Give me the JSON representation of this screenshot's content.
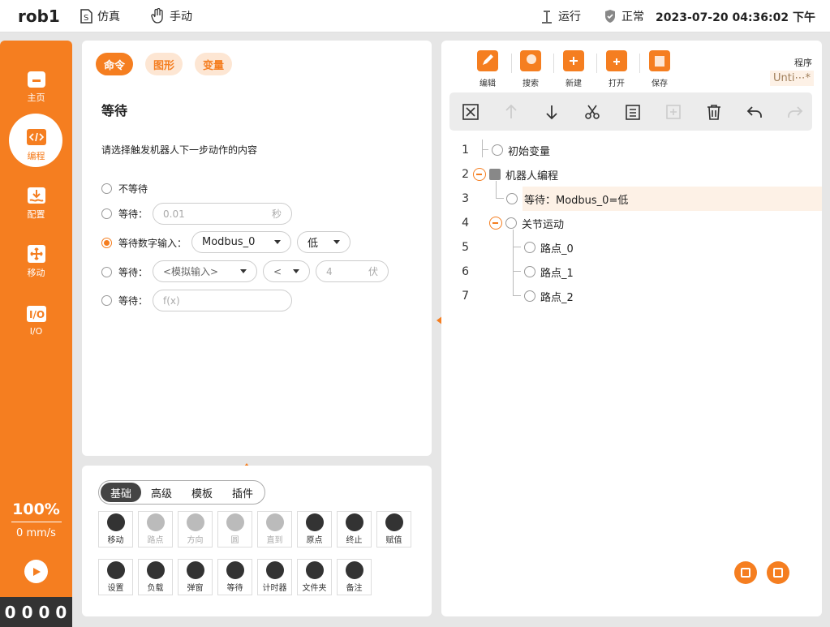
{
  "header": {
    "robot_name": "rob1",
    "mode_sim": "仿真",
    "mode_manual": "手动",
    "run_status": "运行",
    "health_status": "正常",
    "datetime": "2023-07-20 04:36:02 下午"
  },
  "sidebar": {
    "items": [
      {
        "label": "主页",
        "icon": "home-icon"
      },
      {
        "label": "编程",
        "icon": "code-icon"
      },
      {
        "label": "配置",
        "icon": "config-icon"
      },
      {
        "label": "移动",
        "icon": "move-icon"
      },
      {
        "label": "I/O",
        "icon": "io-icon"
      }
    ],
    "active": "编程",
    "speed_percent": "100%",
    "speed_value": "0 mm/s",
    "io_status": "0000"
  },
  "command_panel": {
    "tabs": [
      "命令",
      "图形",
      "变量"
    ],
    "active_tab": "命令",
    "title": "等待",
    "prompt": "请选择触发机器人下一步动作的内容",
    "options": {
      "no_wait": "不等待",
      "wait_time_label": "等待：",
      "wait_time_value": "0.01",
      "wait_time_unit": "秒",
      "digital_label": "等待数字输入：",
      "digital_signal": "Modbus_0",
      "digital_level": "低",
      "analog_label": "等待：",
      "analog_input": "<模拟输入>",
      "analog_op": "<",
      "analog_value": "4",
      "analog_unit": "伏",
      "expr_label": "等待：",
      "expr_placeholder": "f(x)"
    },
    "selected_option": "digital"
  },
  "library": {
    "tabs": [
      "基础",
      "高级",
      "模板",
      "插件"
    ],
    "active_tab": "基础",
    "commands": [
      {
        "label": "移动",
        "icon": "move-cmd-icon",
        "enabled": true
      },
      {
        "label": "路点",
        "icon": "waypoint-add-icon",
        "enabled": false
      },
      {
        "label": "方向",
        "icon": "direction-icon",
        "enabled": false
      },
      {
        "label": "圆",
        "icon": "circle-icon",
        "enabled": false
      },
      {
        "label": "直到",
        "icon": "until-icon",
        "enabled": false
      },
      {
        "label": "原点",
        "icon": "origin-icon",
        "enabled": true
      },
      {
        "label": "终止",
        "icon": "stop-icon",
        "enabled": true
      },
      {
        "label": "赋值",
        "icon": "assign-icon",
        "enabled": true
      },
      {
        "label": "设置",
        "icon": "settings-icon",
        "enabled": true
      },
      {
        "label": "负载",
        "icon": "payload-icon",
        "enabled": true
      },
      {
        "label": "弹窗",
        "icon": "popup-icon",
        "enabled": true
      },
      {
        "label": "等待",
        "icon": "hourglass-icon",
        "enabled": true
      },
      {
        "label": "计时器",
        "icon": "timer-icon",
        "enabled": true
      },
      {
        "label": "文件夹",
        "icon": "folder-icon",
        "enabled": true
      },
      {
        "label": "备注",
        "icon": "comment-icon",
        "enabled": true
      }
    ]
  },
  "program": {
    "toolbar": [
      "编辑",
      "搜索",
      "新建",
      "打开",
      "保存"
    ],
    "label": "程序",
    "name": "Unti⋯*",
    "edit_tools": [
      "delete-node-icon",
      "move-up-icon",
      "move-down-icon",
      "cut-icon",
      "copy-icon",
      "paste-icon",
      "trash-icon",
      "undo-icon",
      "redo-icon"
    ],
    "tree": [
      {
        "line": "1",
        "text": "初始变量"
      },
      {
        "line": "2",
        "text": "机器人编程"
      },
      {
        "line": "3",
        "text": "等待：Modbus_0=低"
      },
      {
        "line": "4",
        "text": "关节运动"
      },
      {
        "line": "5",
        "text": "路点_0"
      },
      {
        "line": "6",
        "text": "路点_1"
      },
      {
        "line": "7",
        "text": "路点_2"
      }
    ],
    "selected_line": "3"
  },
  "colors": {
    "accent": "#f57e20",
    "background": "#e6e6e6",
    "panel": "#ffffff"
  }
}
